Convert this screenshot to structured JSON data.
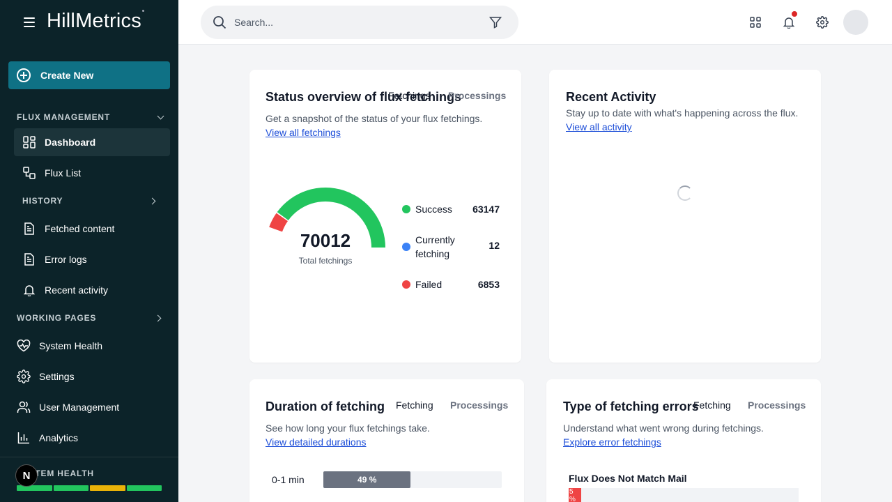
{
  "sidebar": {
    "brand": "HillMetrics",
    "create_label": "Create New",
    "sections": {
      "flux": "FLUX MANAGEMENT",
      "history": "HISTORY",
      "working": "WORKING PAGES",
      "health": "SYSTEM HEALTH"
    },
    "items": {
      "dashboard": "Dashboard",
      "flux_list": "Flux List",
      "fetched": "Fetched content",
      "errors": "Error logs",
      "recent": "Recent activity",
      "system_health": "System Health",
      "settings": "Settings",
      "users": "User Management",
      "analytics": "Analytics"
    },
    "health_segments": [
      "#22c55e",
      "#22c55e",
      "#eab308",
      "#22c55e"
    ],
    "badge": "N"
  },
  "header": {
    "search_placeholder": "Search..."
  },
  "status_card": {
    "title": "Status overview of flux fetchings",
    "tabs": [
      "Fetchings",
      "Processings"
    ],
    "description": "Get a snapshot of the status of your flux fetchings.",
    "link": "View all fetchings",
    "total": "70012",
    "total_label": "Total fetchings",
    "legend": [
      {
        "label": "Success",
        "value": "63147",
        "color": "#22c55e"
      },
      {
        "label": "Currently fetching",
        "value": "12",
        "color": "#3b82f6"
      },
      {
        "label": "Failed",
        "value": "6853",
        "color": "#ef4444"
      }
    ]
  },
  "activity_card": {
    "title": "Recent Activity",
    "description": "Stay up to date with what's happening across the flux.",
    "link": "View all activity"
  },
  "duration_card": {
    "title": "Duration of fetching",
    "tabs": [
      "Fetching",
      "Processings"
    ],
    "description": "See how long your flux fetchings take.",
    "link": "View detailed durations",
    "rows": [
      {
        "label": "0-1 min",
        "percent_text": "49 %",
        "percent": 49
      }
    ]
  },
  "errors_card": {
    "title": "Type of fetching errors",
    "tabs": [
      "Fetching",
      "Processings"
    ],
    "description": "Understand what went wrong during fetchings.",
    "link": "Explore error fetchings",
    "rows": [
      {
        "label": "Flux Does Not Match Mail",
        "value_text": "5 %",
        "percent": 5
      }
    ]
  },
  "chart_data": {
    "type": "pie",
    "title": "",
    "categories": [
      "Success",
      "Currently fetching",
      "Failed"
    ],
    "values": [
      63147,
      12,
      6853
    ],
    "colors": [
      "#22c55e",
      "#3b82f6",
      "#ef4444"
    ],
    "total": 70012
  }
}
